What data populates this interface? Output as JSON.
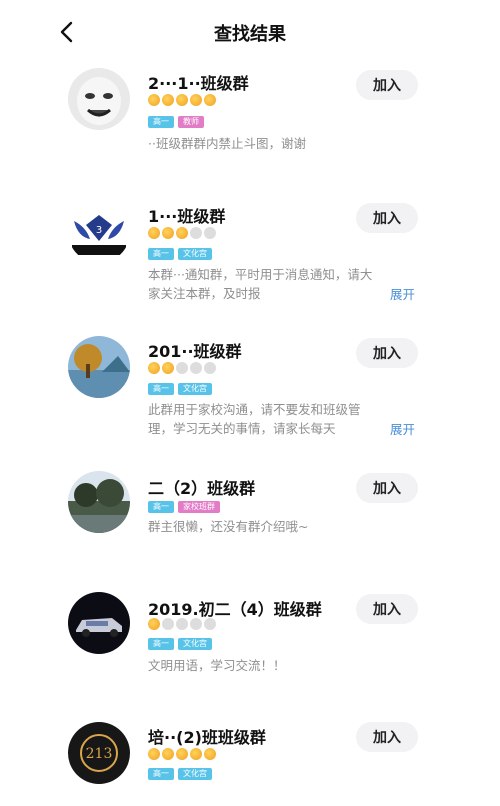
{
  "header": {
    "title": "查找结果"
  },
  "groups": [
    {
      "name": "2···1··班级群",
      "stars": [
        1,
        1,
        1,
        1,
        1
      ],
      "tags": [
        "高一",
        "教师"
      ],
      "desc": "··班级群群内禁止斗图，谢谢",
      "join": "加入"
    },
    {
      "name": "1···班级群",
      "stars": [
        1,
        1,
        1,
        0,
        0
      ],
      "tags": [
        "高一",
        "文化宫"
      ],
      "desc": "本群···通知群，平时用于消息通知，请大家关注本群，及时报",
      "expand": "展开",
      "join": "加入"
    },
    {
      "name": "201··班级群",
      "stars": [
        1,
        1,
        0,
        0,
        0
      ],
      "tags": [
        "高一",
        "文化宫"
      ],
      "desc": "此群用于家校沟通，请不要发和班级管理，学习无关的事情，请家长每天",
      "expand": "展开",
      "join": "加入"
    },
    {
      "name": "二（2）班级群",
      "stars": [],
      "tags": [
        "高一",
        "家校班群"
      ],
      "desc": "群主很懒，还没有群介绍哦~",
      "join": "加入"
    },
    {
      "name": "2019.初二（4）班级群",
      "stars": [
        1,
        0,
        0,
        0,
        0
      ],
      "tags": [
        "高一",
        "文化宫"
      ],
      "desc": "文明用语，学习交流！！",
      "join": "加入"
    },
    {
      "name": "培··(2)班班级群",
      "stars": [
        1,
        1,
        1,
        1,
        1
      ],
      "tags": [
        "高一",
        "文化宫"
      ],
      "desc": "",
      "join": "加入"
    }
  ],
  "avatar_icons": [
    "meme-face-icon",
    "wings-emblem-icon",
    "tree-lake-icon",
    "pond-landscape-icon",
    "car-icon",
    "calligraphy-seal-icon"
  ],
  "colors": {
    "tag_blue": "#58c3e8",
    "tag_pink": "#e27cc6",
    "expand_link": "#4a8fd8",
    "join_bg": "#f2f2f4",
    "star": "#f0a020"
  }
}
